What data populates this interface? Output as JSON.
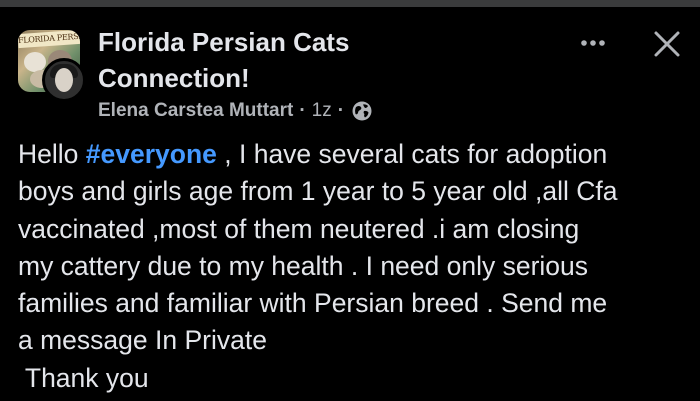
{
  "post": {
    "group_name_line1": "Florida Persian Cats",
    "group_name_line2": "Connection!",
    "group_avatar_text": "FLORIDA PERSIAN CATS",
    "author": "Elena Carstea Muttart",
    "separator": "·",
    "time": "1z",
    "audience_icon": "globe-icon",
    "more_icon": "more-dots-icon",
    "close_icon": "close-icon",
    "body": {
      "greeting": "Hello ",
      "hashtag": "#everyone",
      "line1_rest": " , I have several cats for adoption",
      "line2": "boys and girls age from 1 year to 5 year old ,all Cfa",
      "line3": "vaccinated ,most of them neutered .i am closing",
      "line4": "my cattery due to my health . I need only serious",
      "line5": "families and familiar with Persian breed . Send me",
      "line6": "a message In Private",
      "line7": " Thank you"
    }
  },
  "colors": {
    "background": "#000000",
    "text": "#e4e6eb",
    "secondary_text": "#b0b3b8",
    "hashtag": "#4599ff"
  }
}
